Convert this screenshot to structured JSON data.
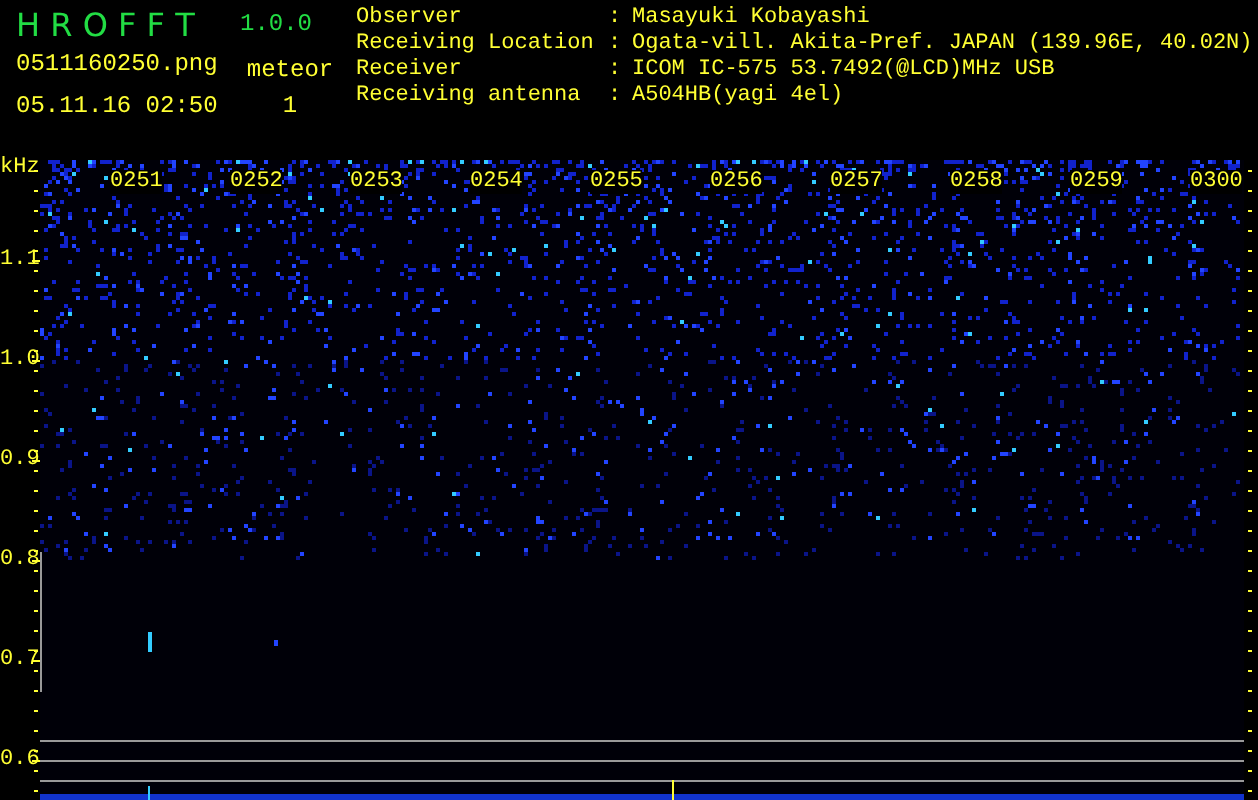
{
  "header": {
    "app_name": "H R O F F T",
    "version": "1.0.0",
    "file_name": "0511160250.png",
    "date_time": "05.11.16 02:50",
    "meteor_label": "meteor",
    "meteor_count": "1"
  },
  "station": [
    {
      "label": "Observer",
      "separator": ":",
      "value": "Masayuki Kobayashi"
    },
    {
      "label": "Receiving Location",
      "separator": ":",
      "value": "Ogata-vill. Akita-Pref. JAPAN (139.96E, 40.02N)"
    },
    {
      "label": "Receiver",
      "separator": ":",
      "value": "ICOM IC-575 53.7492(@LCD)MHz USB"
    },
    {
      "label": "Receiving antenna",
      "separator": ":",
      "value": "A504HB(yagi 4el)"
    }
  ],
  "spectrogram": {
    "unit": "kHz",
    "time_labels": [
      "0251",
      "0252",
      "0253",
      "0254",
      "0255",
      "0256",
      "0257",
      "0258",
      "0259",
      "0300"
    ],
    "frequency_labels": [
      "1.1",
      "1.0",
      "0.9",
      "0.8",
      "0.7",
      "0.6"
    ]
  }
}
